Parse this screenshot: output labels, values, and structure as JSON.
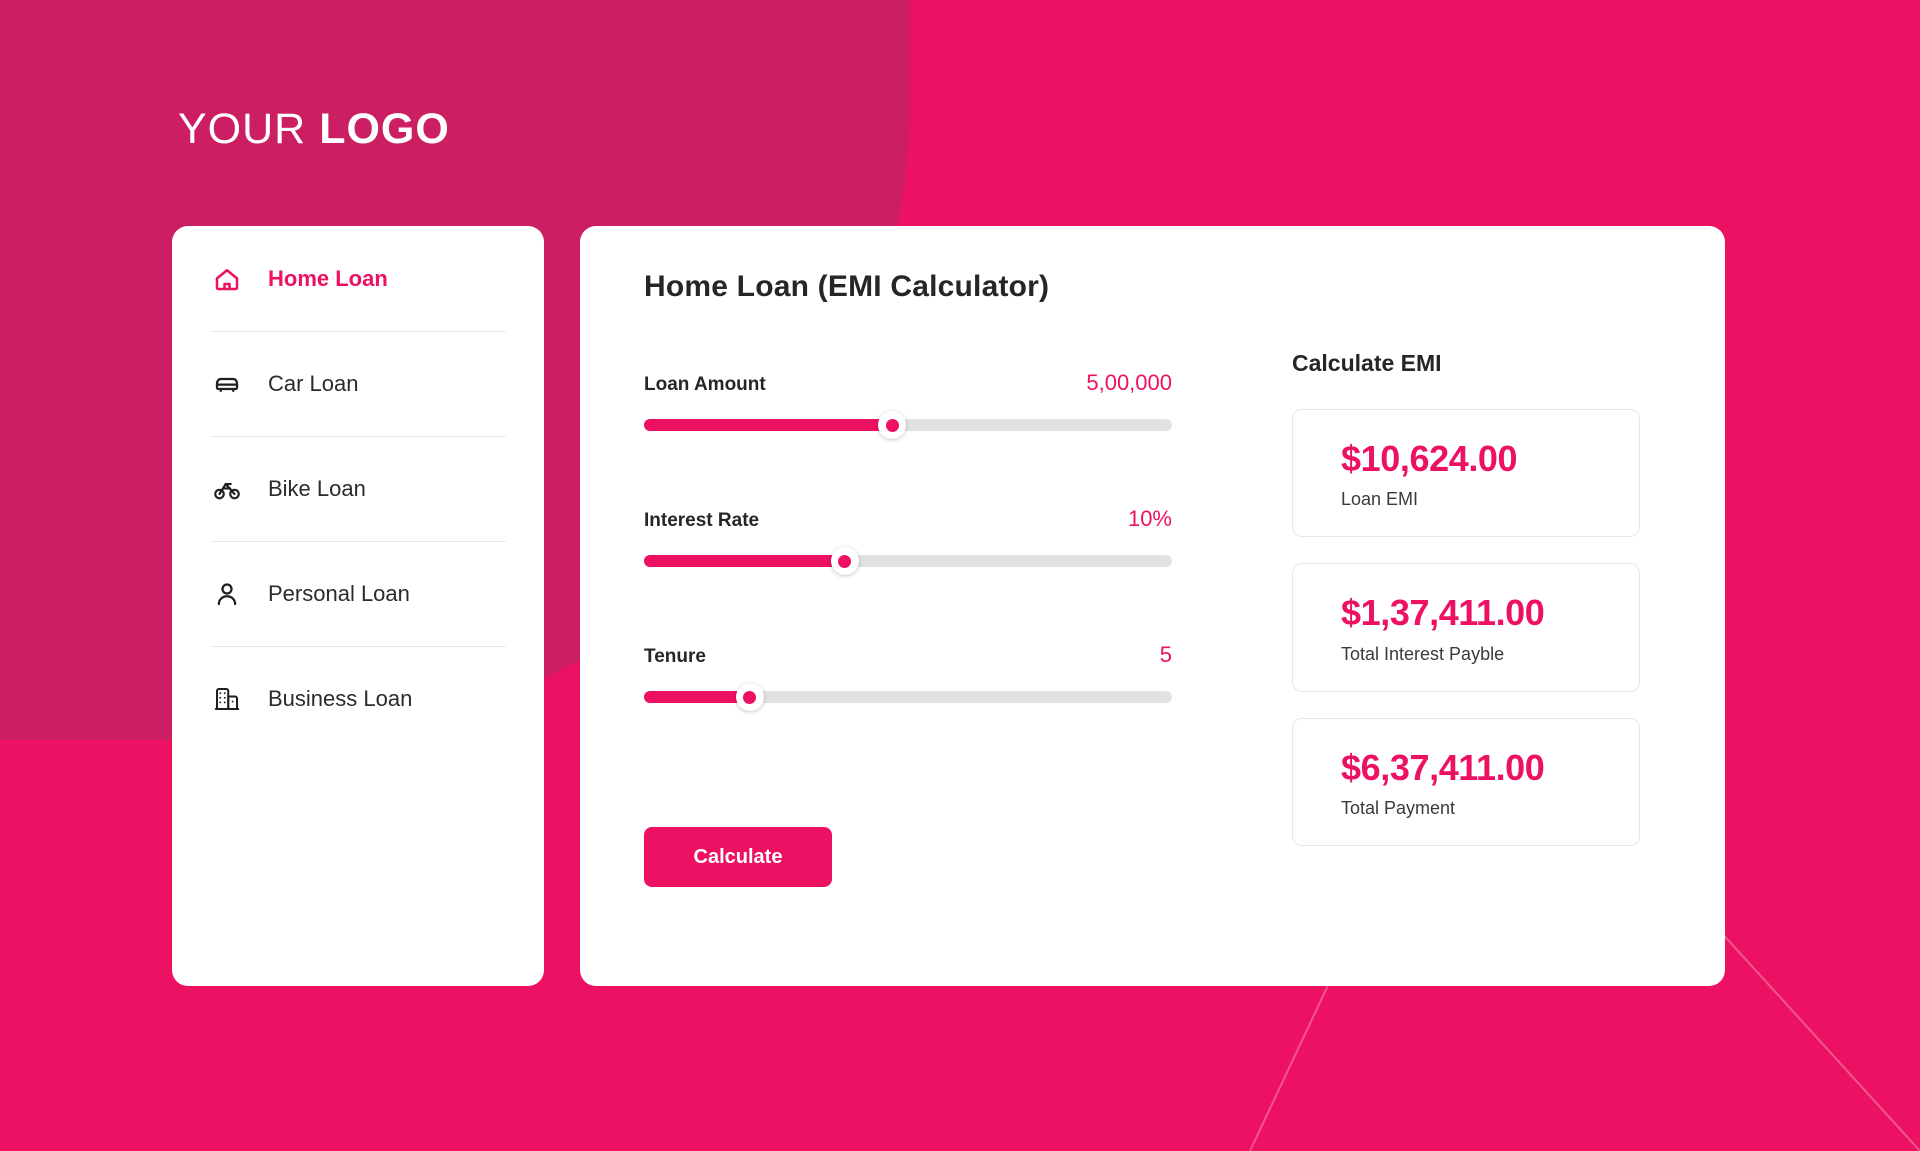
{
  "brand": {
    "logo_thin": "YOUR",
    "logo_bold": "LOGO",
    "accent": "#ED1164",
    "background": "#ED1164",
    "background_overlay": "#CC1E63"
  },
  "sidebar": {
    "items": [
      {
        "label": "Home Loan",
        "icon": "home-icon",
        "active": true
      },
      {
        "label": "Car Loan",
        "icon": "car-icon",
        "active": false
      },
      {
        "label": "Bike Loan",
        "icon": "bike-icon",
        "active": false
      },
      {
        "label": "Personal Loan",
        "icon": "person-icon",
        "active": false
      },
      {
        "label": "Business Loan",
        "icon": "building-icon",
        "active": false
      }
    ]
  },
  "panel": {
    "title": "Home Loan (EMI Calculator)",
    "fields": [
      {
        "label": "Loan Amount",
        "value": "5,00,000",
        "percent": 47
      },
      {
        "label": "Interest Rate",
        "value": "10%",
        "percent": 38
      },
      {
        "label": "Tenure",
        "value": "5",
        "percent": 20
      }
    ],
    "calculate_label": "Calculate"
  },
  "results": {
    "title": "Calculate EMI",
    "cards": [
      {
        "amount": "$10,624.00",
        "caption": "Loan EMI"
      },
      {
        "amount": "$1,37,411.00",
        "caption": "Total Interest Payble"
      },
      {
        "amount": "$6,37,411.00",
        "caption": "Total Payment"
      }
    ]
  }
}
